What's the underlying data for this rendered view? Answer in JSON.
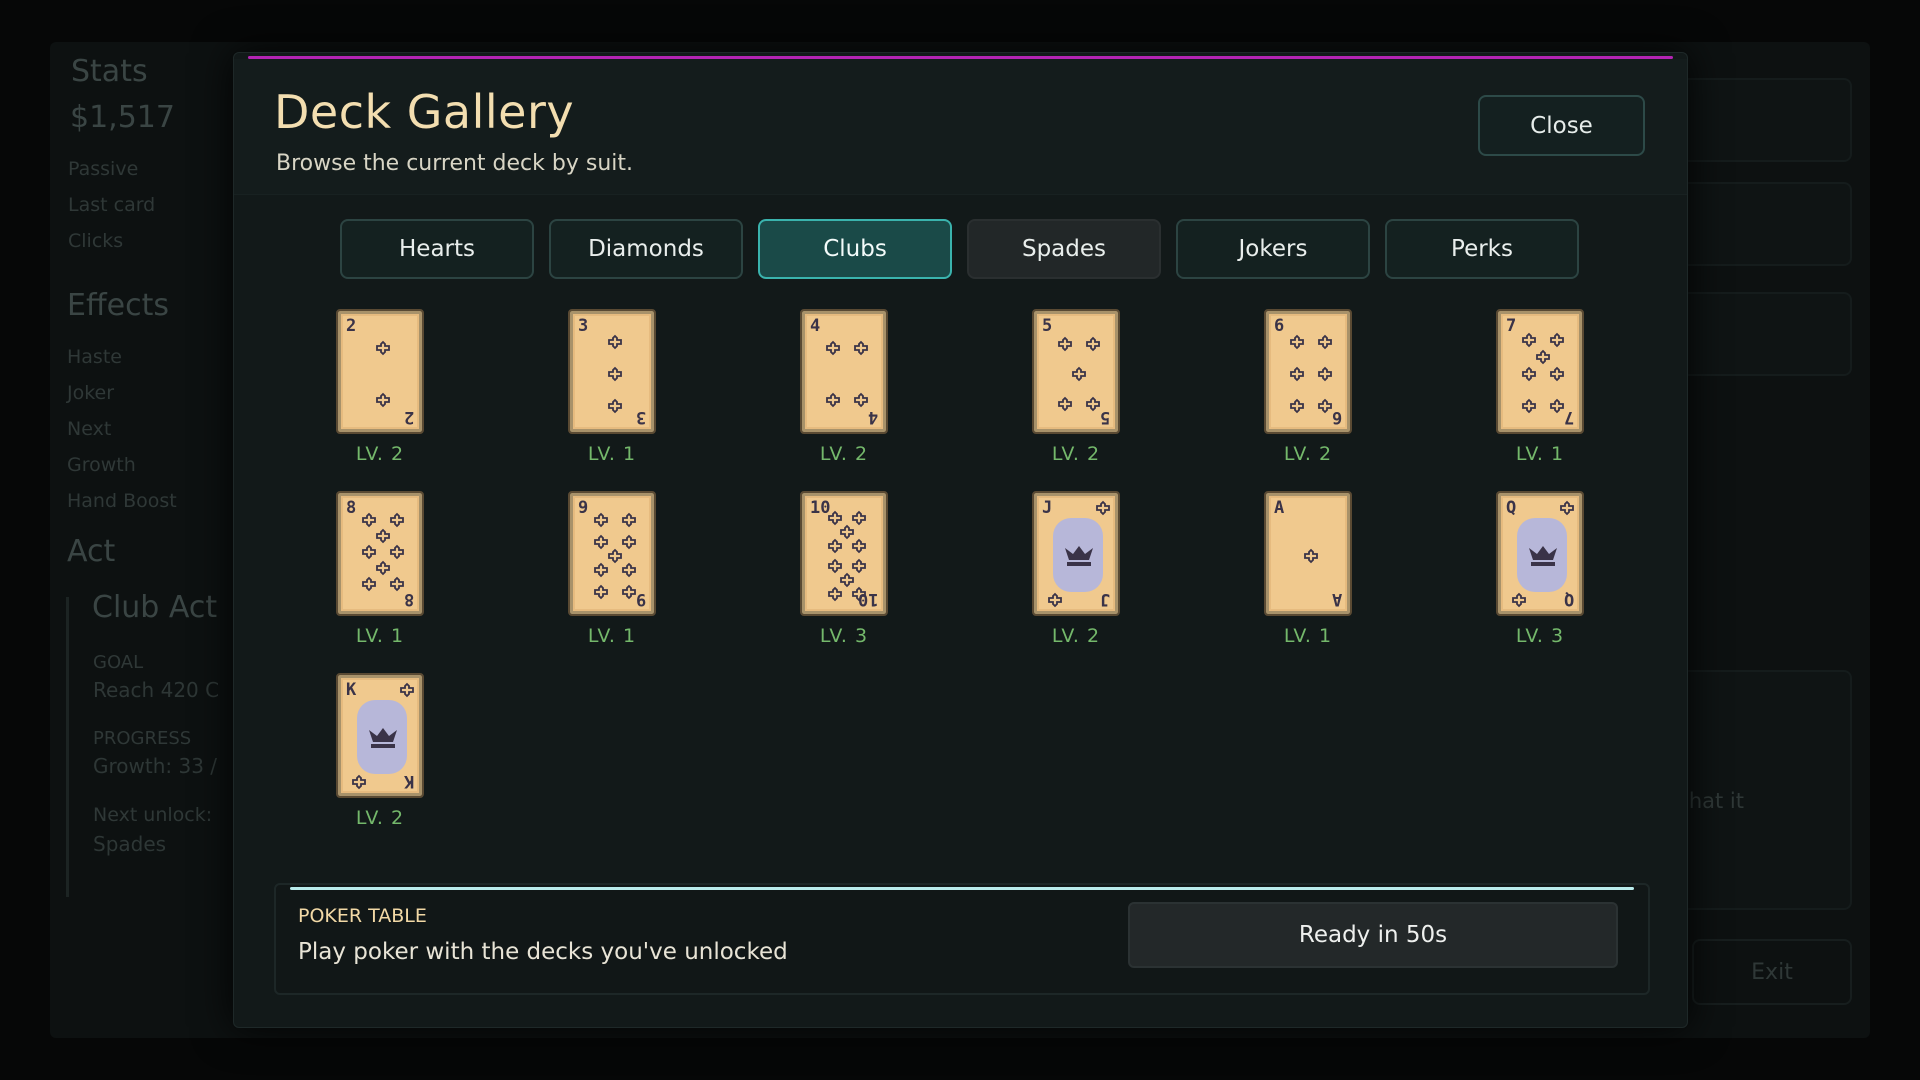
{
  "background": {
    "stats_title": "Stats",
    "money": "$1,517",
    "stats_items": [
      "Passive",
      "Last card",
      "Clicks"
    ],
    "effects_title": "Effects",
    "effects_items": [
      "Haste",
      "Joker",
      "Next",
      "Growth",
      "Hand Boost"
    ],
    "act_title": "Act",
    "act_name": "Club Act",
    "goal_label": "GOAL",
    "goal_text": "Reach 420 C",
    "progress_label": "PROGRESS",
    "progress_text": "Growth: 33 /",
    "next_unlock_label": "Next unlock:",
    "next_unlock_value": "Spades",
    "right_text": "ee what it",
    "exit_label": "Exit"
  },
  "modal": {
    "title": "Deck Gallery",
    "subtitle": "Browse the current deck by suit.",
    "close_label": "Close",
    "accent_color": "#b324b3"
  },
  "tabs": [
    {
      "label": "Hearts",
      "state": "normal"
    },
    {
      "label": "Diamonds",
      "state": "normal"
    },
    {
      "label": "Clubs",
      "state": "active"
    },
    {
      "label": "Spades",
      "state": "locked"
    },
    {
      "label": "Jokers",
      "state": "normal"
    },
    {
      "label": "Perks",
      "state": "normal"
    }
  ],
  "cards": [
    {
      "rank": "2",
      "level": "LV. 2"
    },
    {
      "rank": "3",
      "level": "LV. 1"
    },
    {
      "rank": "4",
      "level": "LV. 2"
    },
    {
      "rank": "5",
      "level": "LV. 2"
    },
    {
      "rank": "6",
      "level": "LV. 2"
    },
    {
      "rank": "7",
      "level": "LV. 1"
    },
    {
      "rank": "8",
      "level": "LV. 1"
    },
    {
      "rank": "9",
      "level": "LV. 1"
    },
    {
      "rank": "10",
      "level": "LV. 3"
    },
    {
      "rank": "J",
      "level": "LV. 2"
    },
    {
      "rank": "A",
      "level": "LV. 1"
    },
    {
      "rank": "Q",
      "level": "LV. 3"
    },
    {
      "rank": "K",
      "level": "LV. 2"
    }
  ],
  "poker": {
    "label": "POKER TABLE",
    "description": "Play poker with the decks you've unlocked",
    "button_label": "Ready in 50s"
  }
}
